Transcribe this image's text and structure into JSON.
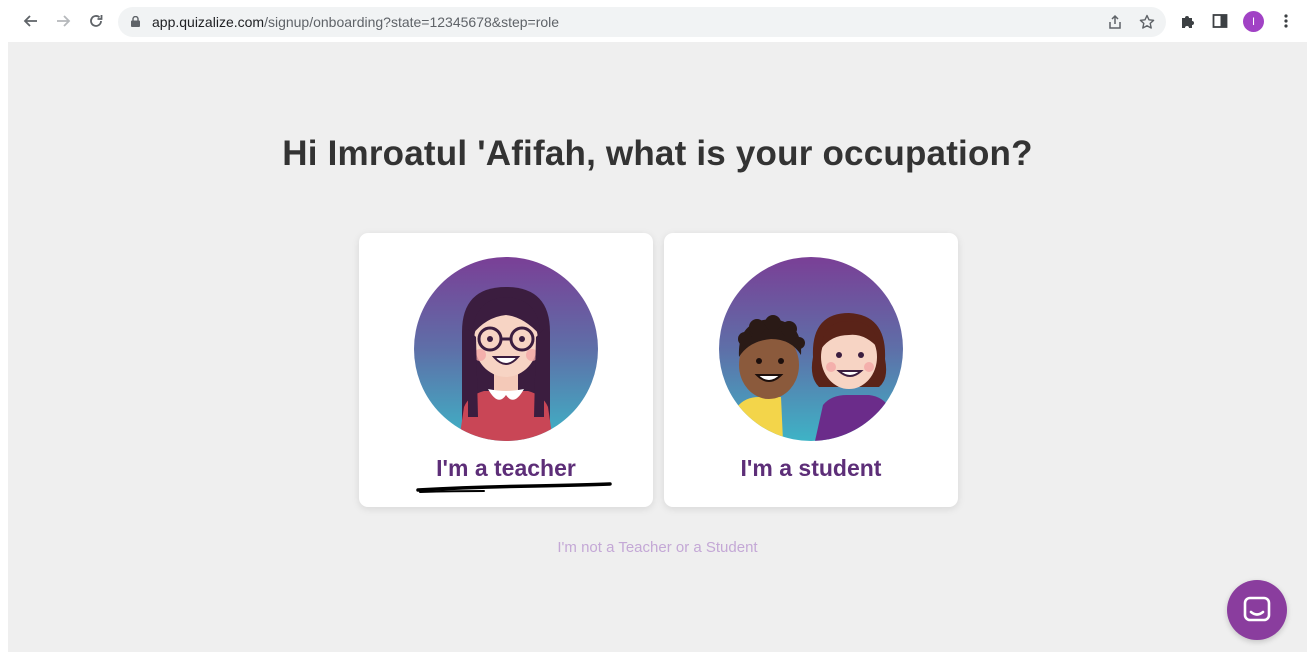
{
  "browser": {
    "url_host": "app.quizalize.com",
    "url_path": "/signup/onboarding?state=12345678&step=role",
    "profile_initial": "I"
  },
  "icons": {
    "back": "arrow-left-icon",
    "forward": "arrow-right-icon",
    "reload": "reload-icon",
    "lock": "lock-icon",
    "share": "share-icon",
    "bookmark": "star-icon",
    "extensions": "puzzle-icon",
    "side_panel": "side-panel-icon",
    "menu": "kebab-menu-icon",
    "chat": "chat-bubble-icon"
  },
  "main": {
    "heading": "Hi Imroatul 'Afifah, what is your occupation?",
    "options": [
      {
        "label": "I'm a teacher"
      },
      {
        "label": "I'm a student"
      }
    ],
    "alt_link": "I'm not a Teacher or a Student"
  },
  "colors": {
    "accent": "#5d2e78",
    "page_bg": "#efefef",
    "link_muted": "#c4a8d6",
    "chat_button": "#8a3d9e",
    "avatar": "#a142c5"
  }
}
